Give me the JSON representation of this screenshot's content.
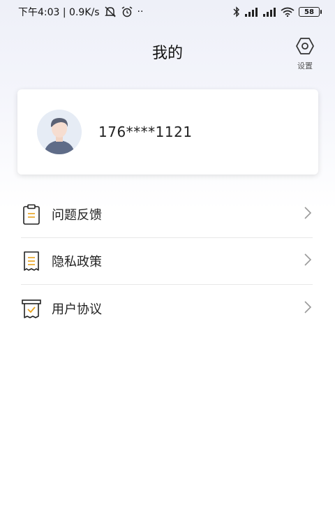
{
  "status_bar": {
    "time_text": "下午4:03 | 0.9K/s",
    "more": "··",
    "battery": "58"
  },
  "header": {
    "title": "我的",
    "settings_label": "设置"
  },
  "profile": {
    "phone": "176****1121"
  },
  "menu": {
    "items": [
      {
        "label": "问题反馈",
        "icon": "clipboard-icon"
      },
      {
        "label": "隐私政策",
        "icon": "receipt-icon"
      },
      {
        "label": "用户协议",
        "icon": "checkbox-document-icon"
      }
    ]
  },
  "colors": {
    "accent": "#e8a21c",
    "text": "#222222",
    "divider": "#e8e8e8",
    "chevron": "#999999"
  }
}
